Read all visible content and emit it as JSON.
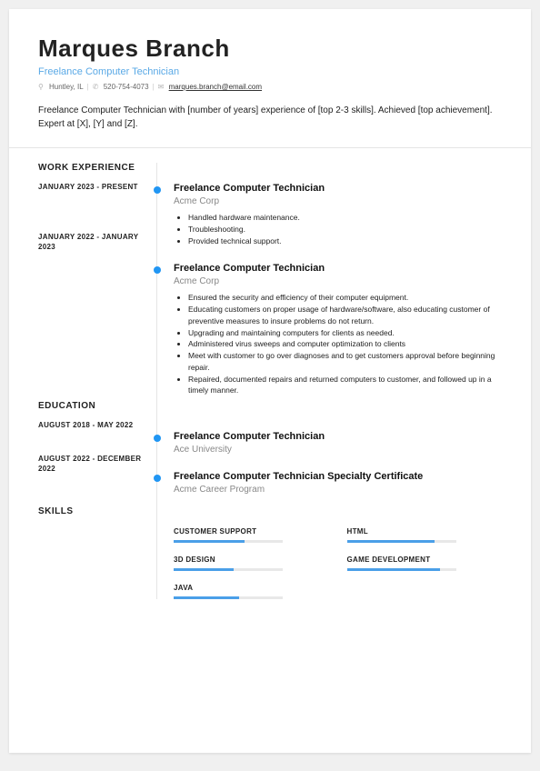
{
  "header": {
    "name": "Marques Branch",
    "title": "Freelance Computer Technician",
    "location": "Huntley, IL",
    "phone": "520-754-4073",
    "email": "marques.branch@email.com"
  },
  "summary": "Freelance Computer Technician with [number of years] experience of [top 2-3 skills]. Achieved [top achievement]. Expert at [X], [Y] and [Z].",
  "sections": {
    "work": "WORK EXPERIENCE",
    "education": "EDUCATION",
    "skills": "SKILLS"
  },
  "work": [
    {
      "date": "JANUARY 2023 - PRESENT",
      "title": "Freelance Computer Technician",
      "company": "Acme Corp",
      "points": [
        "Handled hardware maintenance.",
        "Troubleshooting.",
        "Provided technical support."
      ]
    },
    {
      "date": "JANUARY 2022 - JANUARY 2023",
      "title": "Freelance Computer Technician",
      "company": "Acme Corp",
      "points": [
        "Ensured the security and efficiency of their computer equipment.",
        "Educating customers on proper usage of hardware/software, also educating customer of preventive measures to insure problems do not return.",
        "Upgrading and maintaining computers for clients as needed.",
        "Administered virus sweeps and computer optimization to clients",
        "Meet with customer to go over diagnoses and to get customers approval before beginning repair.",
        "Repaired, documented repairs and returned computers to customer, and followed up in a timely manner."
      ]
    }
  ],
  "education": [
    {
      "date": "AUGUST 2018 - MAY 2022",
      "title": "Freelance Computer Technician",
      "school": "Ace University"
    },
    {
      "date": "AUGUST 2022 - DECEMBER 2022",
      "title": "Freelance Computer Technician Specialty Certificate",
      "school": "Acme Career Program"
    }
  ],
  "skills": [
    {
      "name": "CUSTOMER SUPPORT",
      "level": 65
    },
    {
      "name": "HTML",
      "level": 80
    },
    {
      "name": "3D DESIGN",
      "level": 55
    },
    {
      "name": "GAME DEVELOPMENT",
      "level": 85
    },
    {
      "name": "JAVA",
      "level": 60
    }
  ]
}
